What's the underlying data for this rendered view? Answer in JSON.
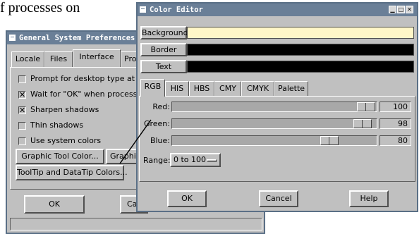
{
  "background_text": "f processes on",
  "general_window": {
    "title": "General System Preferences",
    "tabs": [
      "Locale",
      "Files",
      "Interface",
      "Pro"
    ],
    "active_tab": "Interface",
    "checkboxes": [
      {
        "label": "Prompt for desktop type at star",
        "checked": false
      },
      {
        "label": "Wait for \"OK\" when process co",
        "checked": true
      },
      {
        "label": "Sharpen shadows",
        "checked": true
      },
      {
        "label": "Thin shadows",
        "checked": false
      },
      {
        "label": "Use system colors",
        "checked": false
      }
    ],
    "graphic_tool_color_label": "Graphic Tool Color...",
    "graphic_tool_partial_label": "Graphic To",
    "tooltip_colors_label": "ToolTip and DataTip Colors...",
    "ok_label": "OK",
    "cancel_partial_label": "Ca"
  },
  "color_editor": {
    "title": "Color Editor",
    "targets": [
      {
        "label": "Background",
        "color": "#fff7c8"
      },
      {
        "label": "Border",
        "color": "#000000"
      },
      {
        "label": "Text",
        "color": "#000000"
      }
    ],
    "tabs": [
      "RGB",
      "HIS",
      "HBS",
      "CMY",
      "CMYK",
      "Palette"
    ],
    "active_tab": "RGB",
    "sliders": [
      {
        "label": "Red:",
        "value": "100",
        "fraction": 1.0
      },
      {
        "label": "Green:",
        "value": "98",
        "fraction": 0.98
      },
      {
        "label": "Blue:",
        "value": "80",
        "fraction": 0.8
      }
    ],
    "range_label": "Range:",
    "range_value": "0 to 100",
    "ok_label": "OK",
    "cancel_label": "Cancel",
    "help_label": "Help"
  },
  "colors": {
    "titlebar": "#6a7f97",
    "panel": "#c0c0c0"
  }
}
